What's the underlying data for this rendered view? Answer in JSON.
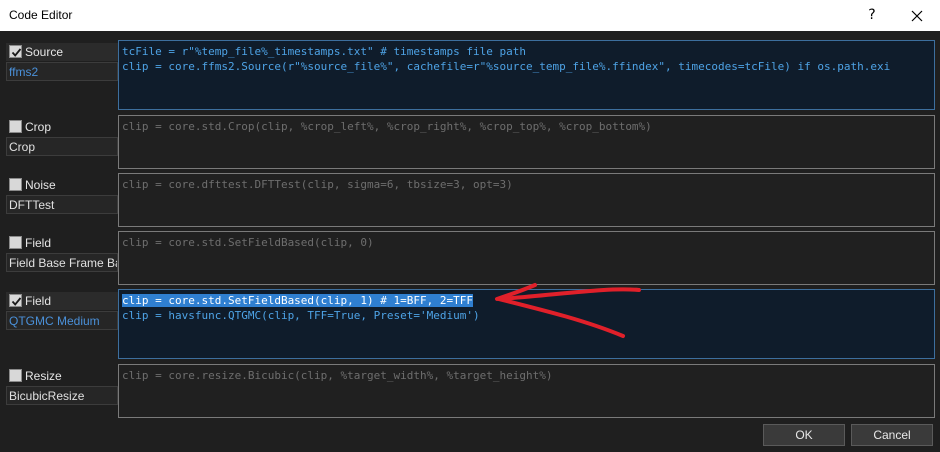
{
  "window": {
    "title": "Code Editor",
    "help_glyph": "?"
  },
  "filters": [
    {
      "checked": true,
      "category": "Source",
      "name": "ffms2",
      "active": true,
      "code": [
        "tcFile = r\"%temp_file%_timestamps.txt\" # timestamps file path",
        "clip = core.ffms2.Source(r\"%source_file%\", cachefile=r\"%source_temp_file%.ffindex\", timecodes=tcFile) if os.path.exi"
      ]
    },
    {
      "checked": false,
      "category": "Crop",
      "name": "Crop",
      "active": false,
      "code": [
        "clip = core.std.Crop(clip, %crop_left%, %crop_right%, %crop_top%, %crop_bottom%)"
      ]
    },
    {
      "checked": false,
      "category": "Noise",
      "name": "DFTTest",
      "active": false,
      "code": [
        "clip = core.dfttest.DFTTest(clip, sigma=6, tbsize=3, opt=3)"
      ]
    },
    {
      "checked": false,
      "category": "Field",
      "name": "Field Base Frame Bas",
      "active": false,
      "code": [
        "clip = core.std.SetFieldBased(clip, 0)"
      ]
    },
    {
      "checked": true,
      "category": "Field",
      "name": "QTGMC Medium",
      "active": true,
      "code": [
        "clip = core.std.SetFieldBased(clip, 1) # 1=BFF, 2=TFF",
        "clip = havsfunc.QTGMC(clip, TFF=True, Preset='Medium')"
      ]
    },
    {
      "checked": false,
      "category": "Resize",
      "name": "BicubicResize",
      "active": false,
      "code": [
        "clip = core.resize.Bicubic(clip, %target_width%, %target_height%)"
      ]
    }
  ],
  "buttons": {
    "ok": "OK",
    "cancel": "Cancel"
  },
  "colors": {
    "background": "#1f1f1f",
    "active_editor": "#0f1c2b",
    "active_code": "#4ea3e6",
    "disabled_code": "#6e6e6e",
    "selection": "#2f7fd1",
    "annotation_arrow": "#e0202a"
  },
  "icons": [
    "check-icon",
    "close-icon",
    "annotation-arrow"
  ]
}
